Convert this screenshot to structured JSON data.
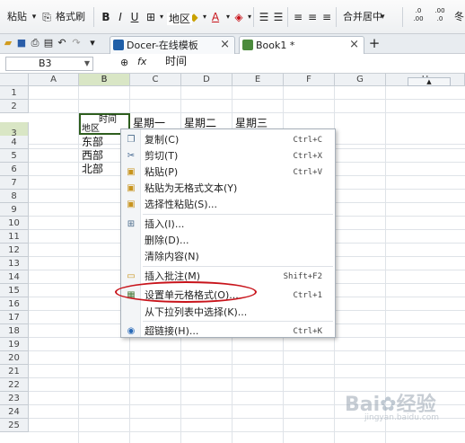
{
  "ribbon": {
    "paste": "粘贴",
    "format_painter": "格式刷",
    "bold": "B",
    "italic": "I",
    "underline": "U",
    "merge_center": "合并居中",
    "merge_arrow": "▾",
    "font_color_glyph": "A",
    "decimal_inc": ".0\n.00",
    "decimal_dec": ".00\n.0",
    "partial_right": "冬"
  },
  "tabs": [
    {
      "label": "Docer-在线模板",
      "icon_color": "#1f5fa8"
    },
    {
      "label": "Book1 *",
      "icon_color": "#4b8a3c"
    }
  ],
  "tab_close": "×",
  "new_tab": "+",
  "formula_bar": {
    "name_box": "B3",
    "fx_label": "fx",
    "content_line1": "时间",
    "content_line2": "地区"
  },
  "columns": [
    "A",
    "B",
    "C",
    "D",
    "E",
    "F",
    "G",
    "H"
  ],
  "rows": [
    "1",
    "2",
    "3",
    "4",
    "5",
    "6",
    "7",
    "8",
    "9",
    "10",
    "11",
    "12",
    "13",
    "14",
    "15",
    "16",
    "17",
    "18",
    "19",
    "20",
    "21",
    "22",
    "23",
    "24",
    "25"
  ],
  "cells": {
    "b3_top": "时间",
    "b3_bottom": "地区",
    "c3": "星期一",
    "d3": "星期二",
    "e3": "星期三",
    "b4": "东部",
    "b5": "西部",
    "b6": "北部"
  },
  "context_menu": [
    {
      "label": "复制(C)",
      "shortcut": "Ctrl+C",
      "icon": "copy-icon"
    },
    {
      "label": "剪切(T)",
      "shortcut": "Ctrl+X",
      "icon": "scissors-icon"
    },
    {
      "label": "粘贴(P)",
      "shortcut": "Ctrl+V",
      "icon": "paste-icon"
    },
    {
      "label": "粘贴为无格式文本(Y)",
      "shortcut": "",
      "icon": "paste-text-icon"
    },
    {
      "label": "选择性粘贴(S)...",
      "shortcut": "",
      "icon": "paste-special-icon"
    },
    {
      "label": "插入(I)...",
      "shortcut": "",
      "icon": "insert-icon"
    },
    {
      "label": "删除(D)...",
      "shortcut": "",
      "icon": ""
    },
    {
      "label": "清除内容(N)",
      "shortcut": "",
      "icon": ""
    },
    {
      "label": "插入批注(M)",
      "shortcut": "Shift+F2",
      "icon": "comment-icon"
    },
    {
      "label": "设置单元格格式(O)...",
      "shortcut": "Ctrl+1",
      "icon": "format-cells-icon"
    },
    {
      "label": "从下拉列表中选择(K)...",
      "shortcut": "",
      "icon": ""
    },
    {
      "label": "超链接(H)...",
      "shortcut": "Ctrl+K",
      "icon": "hyperlink-icon"
    }
  ],
  "colors": {
    "highlight_circle": "#c8141b",
    "selected_header": "#d9e6c5"
  }
}
